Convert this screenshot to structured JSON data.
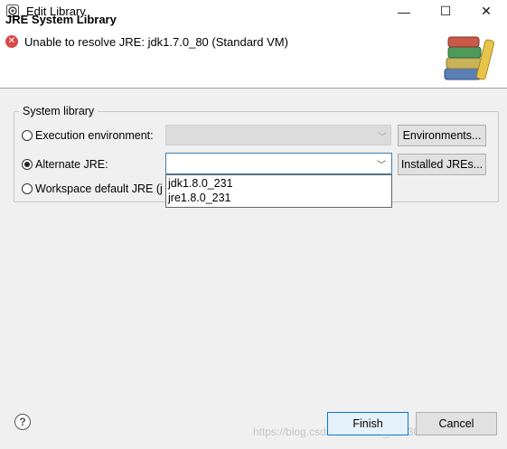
{
  "window": {
    "title": "Edit Library",
    "controls": {
      "minimize": "—",
      "maximize": "☐",
      "close": "✕"
    }
  },
  "header": {
    "title": "JRE System Library",
    "error_icon": "x-circle-icon",
    "error_message": "Unable to resolve JRE: jdk1.7.0_80 (Standard VM)",
    "library_icon": "library-books-icon"
  },
  "group": {
    "label": "System library",
    "options": {
      "execution_environment": {
        "label": "Execution environment:",
        "selected": false,
        "value": ""
      },
      "alternate_jre": {
        "label": "Alternate JRE:",
        "selected": true,
        "value": ""
      },
      "workspace_default": {
        "label": "Workspace default JRE (j",
        "selected": false
      }
    },
    "buttons": {
      "environments": "Environments...",
      "installed_jres": "Installed JREs..."
    }
  },
  "dropdown": {
    "items": [
      "jdk1.8.0_231",
      "jre1.8.0_231"
    ]
  },
  "footer": {
    "help_icon": "help-icon",
    "help_glyph": "?",
    "finish": "Finish",
    "cancel": "Cancel",
    "watermark": "https://blog.csdn.net/weixin_44130082"
  },
  "colors": {
    "dialog_bg": "#f0f0f0",
    "header_bg": "#ffffff",
    "error_red": "#d84a4a",
    "focus_blue": "#0078d7"
  }
}
